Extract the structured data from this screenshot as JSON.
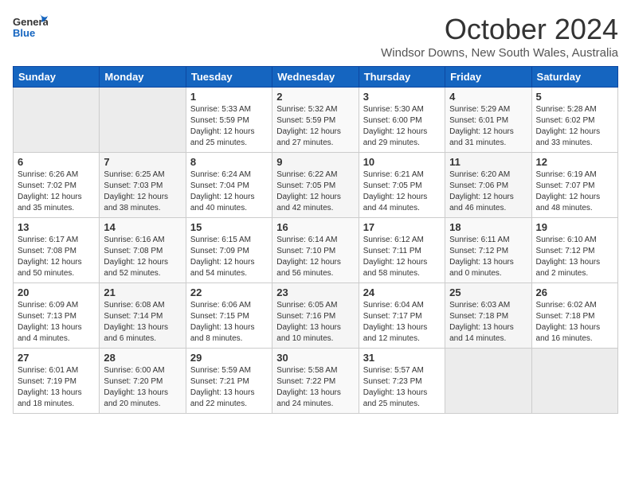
{
  "logo": {
    "line1": "General",
    "line2": "Blue"
  },
  "header": {
    "month": "October 2024",
    "location": "Windsor Downs, New South Wales, Australia"
  },
  "days_of_week": [
    "Sunday",
    "Monday",
    "Tuesday",
    "Wednesday",
    "Thursday",
    "Friday",
    "Saturday"
  ],
  "weeks": [
    [
      {
        "day": "",
        "empty": true
      },
      {
        "day": "",
        "empty": true
      },
      {
        "day": "1",
        "sunrise": "Sunrise: 5:33 AM",
        "sunset": "Sunset: 5:59 PM",
        "daylight": "Daylight: 12 hours and 25 minutes."
      },
      {
        "day": "2",
        "sunrise": "Sunrise: 5:32 AM",
        "sunset": "Sunset: 5:59 PM",
        "daylight": "Daylight: 12 hours and 27 minutes."
      },
      {
        "day": "3",
        "sunrise": "Sunrise: 5:30 AM",
        "sunset": "Sunset: 6:00 PM",
        "daylight": "Daylight: 12 hours and 29 minutes."
      },
      {
        "day": "4",
        "sunrise": "Sunrise: 5:29 AM",
        "sunset": "Sunset: 6:01 PM",
        "daylight": "Daylight: 12 hours and 31 minutes."
      },
      {
        "day": "5",
        "sunrise": "Sunrise: 5:28 AM",
        "sunset": "Sunset: 6:02 PM",
        "daylight": "Daylight: 12 hours and 33 minutes."
      }
    ],
    [
      {
        "day": "6",
        "sunrise": "Sunrise: 6:26 AM",
        "sunset": "Sunset: 7:02 PM",
        "daylight": "Daylight: 12 hours and 35 minutes."
      },
      {
        "day": "7",
        "sunrise": "Sunrise: 6:25 AM",
        "sunset": "Sunset: 7:03 PM",
        "daylight": "Daylight: 12 hours and 38 minutes."
      },
      {
        "day": "8",
        "sunrise": "Sunrise: 6:24 AM",
        "sunset": "Sunset: 7:04 PM",
        "daylight": "Daylight: 12 hours and 40 minutes."
      },
      {
        "day": "9",
        "sunrise": "Sunrise: 6:22 AM",
        "sunset": "Sunset: 7:05 PM",
        "daylight": "Daylight: 12 hours and 42 minutes."
      },
      {
        "day": "10",
        "sunrise": "Sunrise: 6:21 AM",
        "sunset": "Sunset: 7:05 PM",
        "daylight": "Daylight: 12 hours and 44 minutes."
      },
      {
        "day": "11",
        "sunrise": "Sunrise: 6:20 AM",
        "sunset": "Sunset: 7:06 PM",
        "daylight": "Daylight: 12 hours and 46 minutes."
      },
      {
        "day": "12",
        "sunrise": "Sunrise: 6:19 AM",
        "sunset": "Sunset: 7:07 PM",
        "daylight": "Daylight: 12 hours and 48 minutes."
      }
    ],
    [
      {
        "day": "13",
        "sunrise": "Sunrise: 6:17 AM",
        "sunset": "Sunset: 7:08 PM",
        "daylight": "Daylight: 12 hours and 50 minutes."
      },
      {
        "day": "14",
        "sunrise": "Sunrise: 6:16 AM",
        "sunset": "Sunset: 7:08 PM",
        "daylight": "Daylight: 12 hours and 52 minutes."
      },
      {
        "day": "15",
        "sunrise": "Sunrise: 6:15 AM",
        "sunset": "Sunset: 7:09 PM",
        "daylight": "Daylight: 12 hours and 54 minutes."
      },
      {
        "day": "16",
        "sunrise": "Sunrise: 6:14 AM",
        "sunset": "Sunset: 7:10 PM",
        "daylight": "Daylight: 12 hours and 56 minutes."
      },
      {
        "day": "17",
        "sunrise": "Sunrise: 6:12 AM",
        "sunset": "Sunset: 7:11 PM",
        "daylight": "Daylight: 12 hours and 58 minutes."
      },
      {
        "day": "18",
        "sunrise": "Sunrise: 6:11 AM",
        "sunset": "Sunset: 7:12 PM",
        "daylight": "Daylight: 13 hours and 0 minutes."
      },
      {
        "day": "19",
        "sunrise": "Sunrise: 6:10 AM",
        "sunset": "Sunset: 7:12 PM",
        "daylight": "Daylight: 13 hours and 2 minutes."
      }
    ],
    [
      {
        "day": "20",
        "sunrise": "Sunrise: 6:09 AM",
        "sunset": "Sunset: 7:13 PM",
        "daylight": "Daylight: 13 hours and 4 minutes."
      },
      {
        "day": "21",
        "sunrise": "Sunrise: 6:08 AM",
        "sunset": "Sunset: 7:14 PM",
        "daylight": "Daylight: 13 hours and 6 minutes."
      },
      {
        "day": "22",
        "sunrise": "Sunrise: 6:06 AM",
        "sunset": "Sunset: 7:15 PM",
        "daylight": "Daylight: 13 hours and 8 minutes."
      },
      {
        "day": "23",
        "sunrise": "Sunrise: 6:05 AM",
        "sunset": "Sunset: 7:16 PM",
        "daylight": "Daylight: 13 hours and 10 minutes."
      },
      {
        "day": "24",
        "sunrise": "Sunrise: 6:04 AM",
        "sunset": "Sunset: 7:17 PM",
        "daylight": "Daylight: 13 hours and 12 minutes."
      },
      {
        "day": "25",
        "sunrise": "Sunrise: 6:03 AM",
        "sunset": "Sunset: 7:18 PM",
        "daylight": "Daylight: 13 hours and 14 minutes."
      },
      {
        "day": "26",
        "sunrise": "Sunrise: 6:02 AM",
        "sunset": "Sunset: 7:18 PM",
        "daylight": "Daylight: 13 hours and 16 minutes."
      }
    ],
    [
      {
        "day": "27",
        "sunrise": "Sunrise: 6:01 AM",
        "sunset": "Sunset: 7:19 PM",
        "daylight": "Daylight: 13 hours and 18 minutes."
      },
      {
        "day": "28",
        "sunrise": "Sunrise: 6:00 AM",
        "sunset": "Sunset: 7:20 PM",
        "daylight": "Daylight: 13 hours and 20 minutes."
      },
      {
        "day": "29",
        "sunrise": "Sunrise: 5:59 AM",
        "sunset": "Sunset: 7:21 PM",
        "daylight": "Daylight: 13 hours and 22 minutes."
      },
      {
        "day": "30",
        "sunrise": "Sunrise: 5:58 AM",
        "sunset": "Sunset: 7:22 PM",
        "daylight": "Daylight: 13 hours and 24 minutes."
      },
      {
        "day": "31",
        "sunrise": "Sunrise: 5:57 AM",
        "sunset": "Sunset: 7:23 PM",
        "daylight": "Daylight: 13 hours and 25 minutes."
      },
      {
        "day": "",
        "empty": true
      },
      {
        "day": "",
        "empty": true
      }
    ]
  ]
}
